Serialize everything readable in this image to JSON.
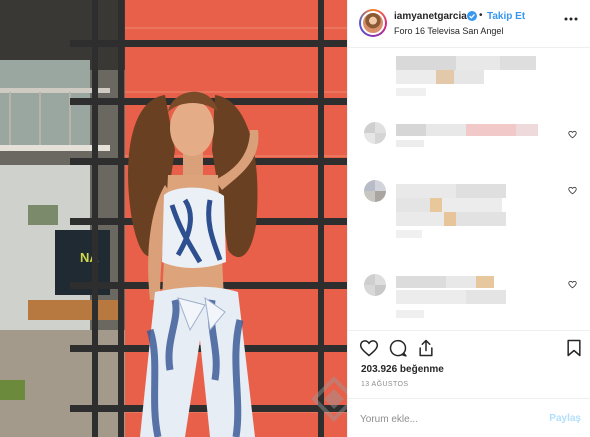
{
  "post": {
    "username": "iamyanetgarcia",
    "verified": true,
    "separator": "•",
    "follow_label": "Takip Et",
    "location": "Foro 16 Televisa San Angel",
    "more_icon": "more-horizontal-icon"
  },
  "photo": {
    "screen_text": "NA"
  },
  "engagement": {
    "likes_text": "203.926 beğenme",
    "date_text": "13 AĞUSTOS"
  },
  "comment_box": {
    "placeholder": "Yorum ekle...",
    "post_label": "Paylaş"
  },
  "colors": {
    "accent": "#3897f0",
    "post_disabled": "#b2dffc",
    "wall": "#e8604a",
    "scaffold": "#2e2e2e"
  },
  "icons": [
    "like-icon",
    "comment-icon",
    "share-icon",
    "save-icon"
  ]
}
